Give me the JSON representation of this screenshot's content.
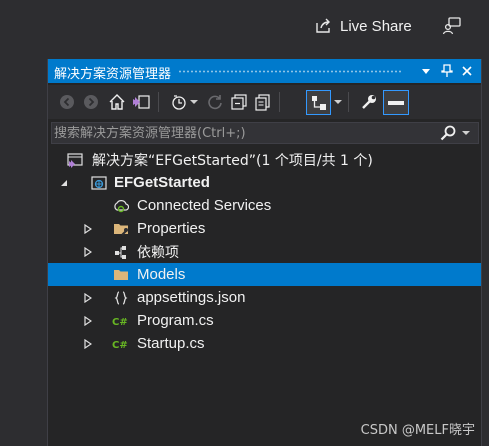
{
  "topbar": {
    "live_share_label": "Live Share",
    "icons": [
      "live-share-icon",
      "feedback-icon"
    ]
  },
  "panel": {
    "title": "解决方案资源管理器",
    "title_buttons": [
      "dropdown-arrow-icon",
      "pin-icon",
      "close-icon"
    ],
    "toolbar_icons": [
      "back-icon",
      "forward-icon",
      "home-icon",
      "switch-views-icon",
      "pending-changes-filter-icon",
      "dropdown-arrow-icon",
      "sync-icon",
      "collapse-all-icon",
      "show-all-files-icon",
      "preview-selected-icon",
      "dropdown-arrow-icon",
      "properties-wrench-icon",
      "minus-icon"
    ],
    "search_placeholder": "搜索解决方案资源管理器(Ctrl+;)"
  },
  "tree": {
    "items": [
      {
        "label": "解决方案“EFGetStarted”(1 个项目/共 1 个)",
        "icon": "solution-icon",
        "expander": "",
        "level": 0
      },
      {
        "label": "EFGetStarted",
        "icon": "web-project-icon",
        "expander": "expanded",
        "level": 1,
        "bold": true
      },
      {
        "label": "Connected Services",
        "icon": "connected-services-icon",
        "expander": "",
        "level": 2
      },
      {
        "label": "Properties",
        "icon": "properties-folder-icon",
        "expander": "collapsed",
        "level": 2
      },
      {
        "label": "依赖项",
        "icon": "dependencies-icon",
        "expander": "collapsed",
        "level": 2
      },
      {
        "label": "Models",
        "icon": "folder-icon",
        "expander": "",
        "level": 2,
        "selected": true
      },
      {
        "label": "appsettings.json",
        "icon": "json-file-icon",
        "expander": "collapsed",
        "level": 2
      },
      {
        "label": "Program.cs",
        "icon": "csharp-file-icon",
        "expander": "collapsed",
        "level": 2
      },
      {
        "label": "Startup.cs",
        "icon": "csharp-file-icon",
        "expander": "collapsed",
        "level": 2
      }
    ]
  },
  "watermark": "CSDN @MELF晓宇",
  "colors": {
    "accent": "#007acc",
    "background": "#252526",
    "csharp": "#68b723",
    "folder": "#dcb67a"
  }
}
